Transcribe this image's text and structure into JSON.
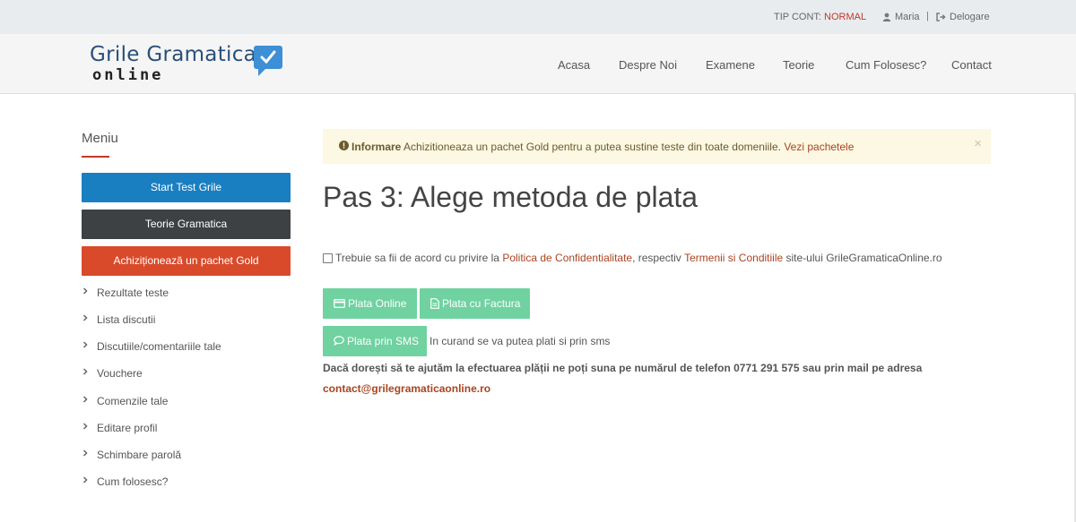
{
  "topbar": {
    "tip_label": "TIP CONT:",
    "tip_value": "NORMAL",
    "user_name": "Maria",
    "separator": "|",
    "logout": "Delogare"
  },
  "logo": {
    "line1": "Grile Gramatica",
    "line2": "online"
  },
  "nav": [
    "Acasa",
    "Despre Noi",
    "Examene",
    "Teorie",
    "Cum Folosesc?",
    "Contact"
  ],
  "sidebar": {
    "title": "Meniu",
    "buttons": {
      "start": "Start Test Grile",
      "teorie": "Teorie Gramatica",
      "gold": "Achiziționează un pachet Gold"
    },
    "items": [
      "Rezultate teste",
      "Lista discutii",
      "Discutiile/comentariile tale",
      "Vouchere",
      "Comenzile tale",
      "Editare profil",
      "Schimbare parolă",
      "Cum folosesc?"
    ]
  },
  "alert": {
    "title": "Informare",
    "message": "Achizitioneaza un pachet Gold pentru a putea sustine teste din toate domeniile.",
    "link": "Vezi pachetele",
    "close": "×"
  },
  "page_title": "Pas 3: Alege metoda de plata",
  "agreement": {
    "prefix": "Trebuie sa fii de acord cu privire la",
    "privacy_link": "Politica de Confidentialitate",
    "middle": ", respectiv",
    "terms_link": "Termenii si Conditiile",
    "suffix": "site-ului GrileGramaticaOnline.ro"
  },
  "payment": {
    "online": "Plata Online",
    "factura": "Plata cu Factura",
    "sms": "Plata prin SMS",
    "sms_note": "In curand se va putea plati si prin sms"
  },
  "help_text": "Dacă dorești să te ajutăm la efectuarea plății ne poți suna pe numărul de telefon 0771 291 575 sau prin mail pe adresa",
  "email": "contact@grilegramaticaonline.ro",
  "colors": {
    "accent": "#c0392b",
    "start_button": "#1a7fc1",
    "teorie_button": "#3e4143",
    "gold_button": "#d94a2b",
    "pay_button": "#6fd2a0",
    "alert_bg": "#fcf8e3"
  }
}
